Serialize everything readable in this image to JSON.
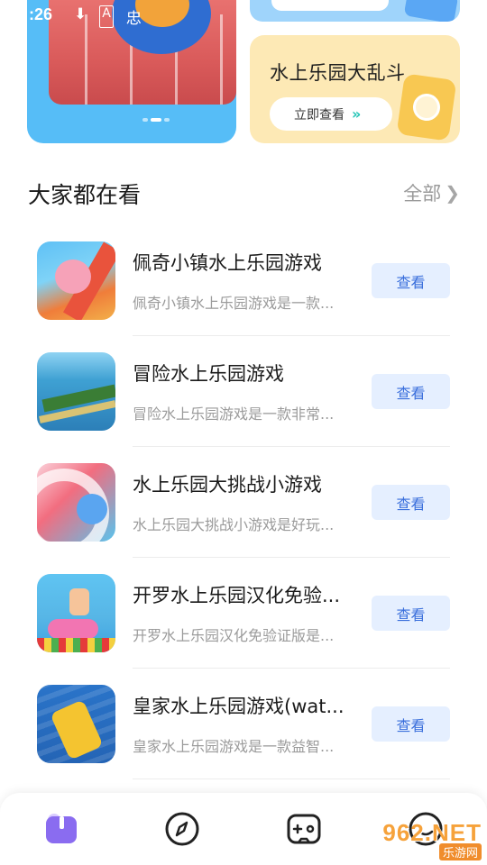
{
  "status_bar": {
    "time": ":26",
    "icons": [
      "download-icon",
      "a-icon",
      "signal-icon"
    ]
  },
  "banners": {
    "right_card": {
      "title": "水上乐园大乱斗",
      "button_label": "立即查看",
      "button_arrow": "»"
    }
  },
  "section": {
    "title": "大家都在看",
    "more_label": "全部",
    "more_icon": "chevron-right-icon"
  },
  "items": [
    {
      "name": "佩奇小镇水上乐园游戏",
      "desc": "佩奇小镇水上乐园游戏是一款...",
      "button": "查看"
    },
    {
      "name": "冒险水上乐园游戏",
      "desc": "冒险水上乐园游戏是一款非常...",
      "button": "查看"
    },
    {
      "name": "水上乐园大挑战小游戏",
      "desc": "水上乐园大挑战小游戏是好玩...",
      "button": "查看"
    },
    {
      "name": "开罗水上乐园汉化免验...",
      "desc": "开罗水上乐园汉化免验证版是...",
      "button": "查看"
    },
    {
      "name": "皇家水上乐园游戏(wat...",
      "desc": "皇家水上乐园游戏是一款益智...",
      "button": "查看"
    }
  ],
  "tabbar": {
    "tabs": [
      {
        "icon": "book-icon",
        "active": true
      },
      {
        "icon": "compass-icon",
        "active": false
      },
      {
        "icon": "gamepad-icon",
        "active": false
      },
      {
        "icon": "profile-icon",
        "active": false
      }
    ]
  },
  "watermark": {
    "big": "962.NET",
    "small": "乐游网"
  },
  "colors": {
    "accent_blue": "#3a6fdc",
    "button_bg": "#e5efff",
    "banner_blue": "#56bdf7",
    "banner_yellow": "#fde9b5",
    "arrow_teal": "#23c4b6",
    "tab_active": "#8a6cf0"
  }
}
